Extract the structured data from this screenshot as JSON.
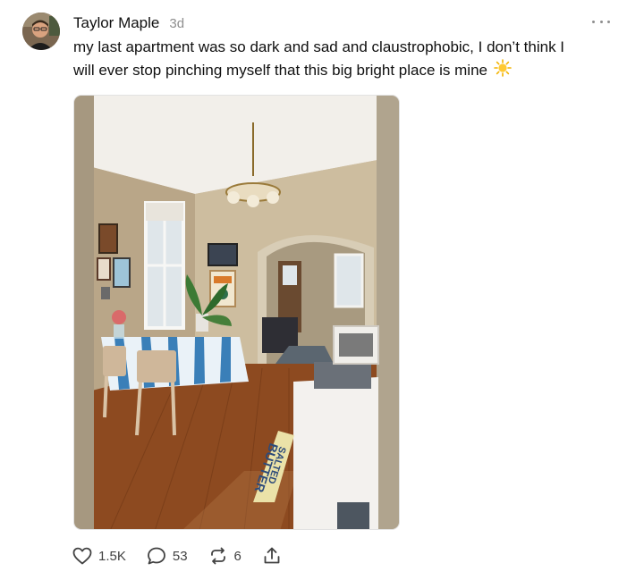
{
  "post": {
    "author": "Taylor Maple",
    "timestamp": "3d",
    "text_line1": "my last apartment was so dark and sad and claustrophobic, I don’t think I",
    "text_line2": "will ever stop pinching myself that this big bright place is mine",
    "emoji": "sun-emoji",
    "image": {
      "rug_text_1": "SALTED",
      "rug_text_2": "BUTTER"
    },
    "actions": {
      "likes": "1.5K",
      "comments": "53",
      "reposts": "6"
    },
    "icons": {
      "like": "heart-icon",
      "comment": "speech-bubble-icon",
      "repost": "repost-arrows-icon",
      "share": "share-icon",
      "more": "more-options-icon"
    }
  },
  "colors": {
    "text": "#101010",
    "secondary": "#8e8e8e",
    "wall": "#c9b89c",
    "floor": "#8a4a22",
    "tablecloth_stripe": "#3a7fb8"
  }
}
